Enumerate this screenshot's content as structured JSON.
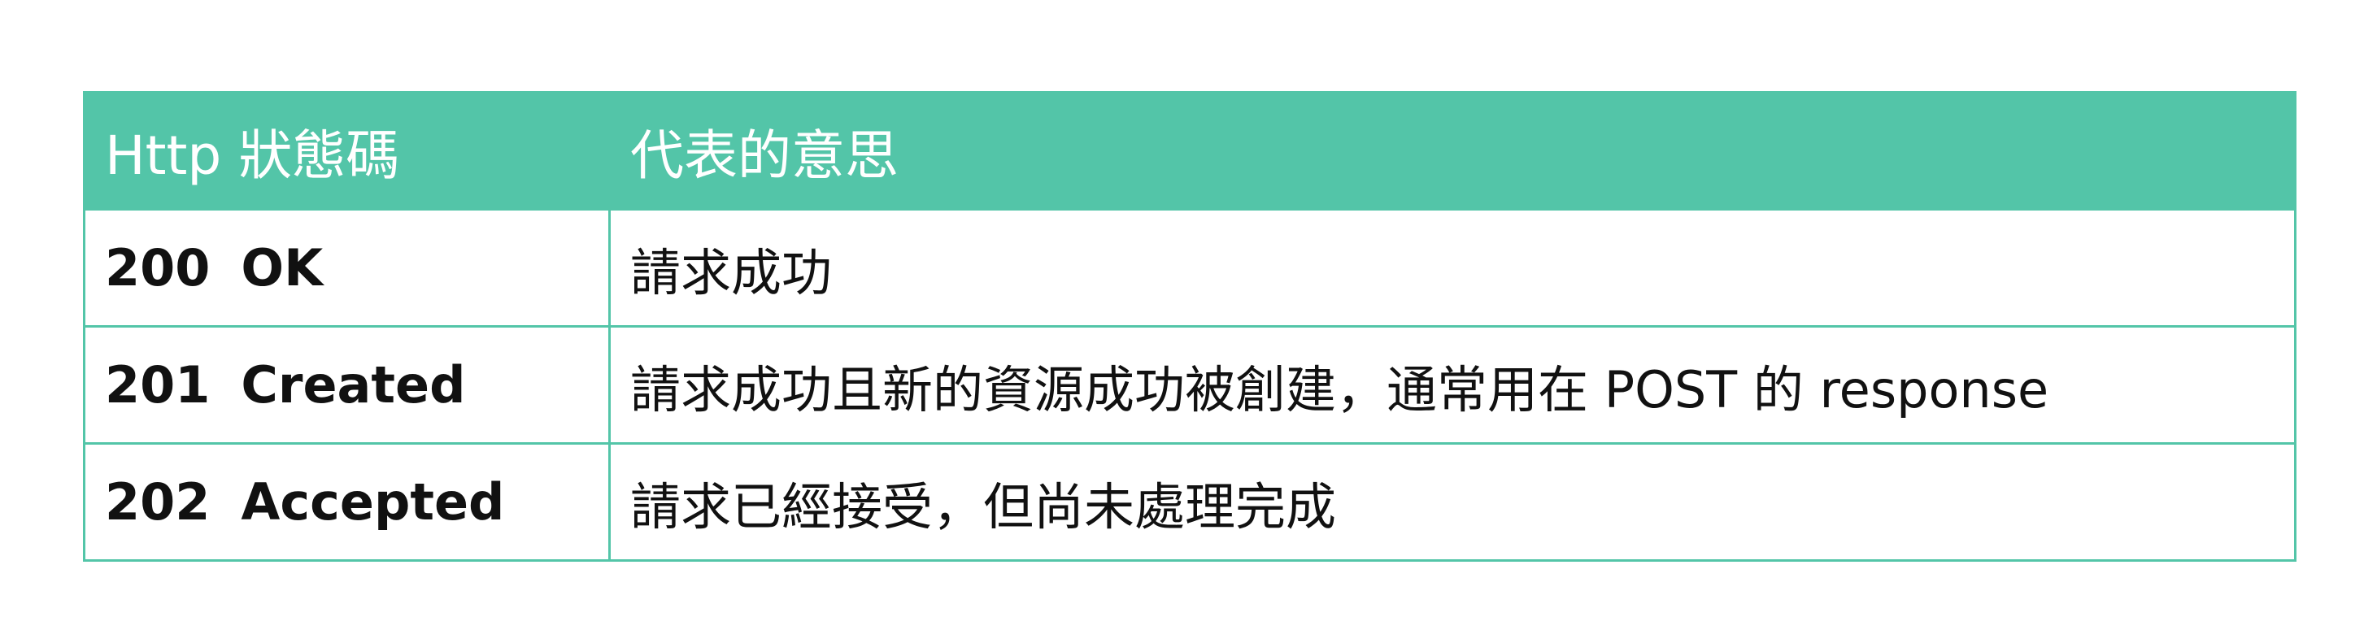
{
  "table": {
    "headers": [
      "Http 狀態碼",
      "代表的意思"
    ],
    "rows": [
      {
        "code": "200",
        "name": "OK",
        "meaning": "請求成功"
      },
      {
        "code": "201",
        "name": "Created",
        "meaning": "請求成功且新的資源成功被創建，通常用在 POST 的 response"
      },
      {
        "code": "202",
        "name": "Accepted",
        "meaning": "請求已經接受，但尚未處理完成"
      }
    ]
  },
  "colors": {
    "header_background": "#53c5a8",
    "header_text": "#ffffff",
    "border": "#53c5a8",
    "body_text": "#111111"
  }
}
